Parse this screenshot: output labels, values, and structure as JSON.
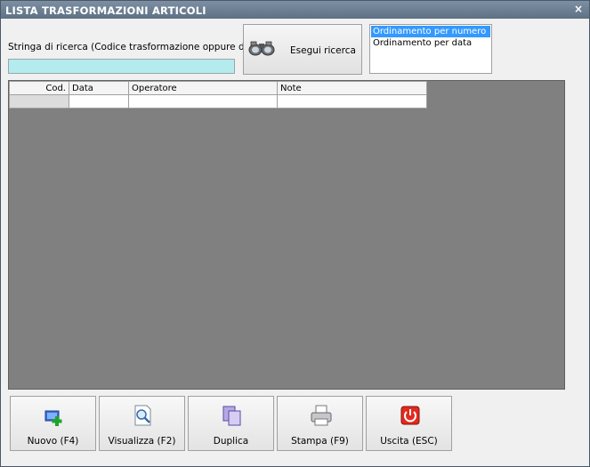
{
  "window": {
    "title": "LISTA TRASFORMAZIONI ARTICOLI",
    "close_label": "×"
  },
  "search": {
    "label": "Stringa di ricerca (Codice trasformazione oppure data)",
    "value": "",
    "button_label": "Esegui ricerca"
  },
  "sort_options": [
    "Ordinamento per numero",
    "Ordinamento per data"
  ],
  "selected_sort": "Ordinamento per numero",
  "grid": {
    "columns": [
      "Cod.",
      "Data",
      "Operatore",
      "Note"
    ],
    "rows": [
      [
        "",
        "",
        "",
        ""
      ]
    ]
  },
  "buttons": {
    "nuovo": "Nuovo (F4)",
    "visualizza": "Visualizza (F2)",
    "duplica": "Duplica",
    "stampa": "Stampa (F9)",
    "uscita": "Uscita (ESC)"
  },
  "icons": {
    "search": "binoculars-icon",
    "nuovo": "new-item-icon",
    "visualizza": "magnifier-document-icon",
    "duplica": "duplicate-icon",
    "stampa": "printer-icon",
    "uscita": "power-icon"
  }
}
